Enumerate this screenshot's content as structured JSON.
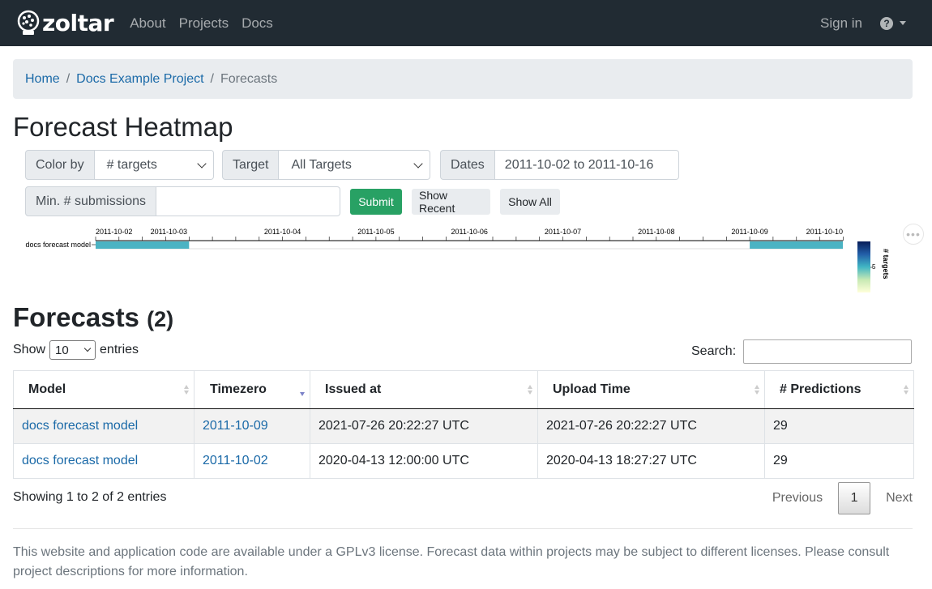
{
  "navbar": {
    "brand": "zoltar",
    "links": [
      "About",
      "Projects",
      "Docs"
    ],
    "sign_in": "Sign in",
    "help_glyph": "?"
  },
  "breadcrumb": {
    "home": "Home",
    "project": "Docs Example Project",
    "current": "Forecasts",
    "separator": "/"
  },
  "page_title": "Forecast Heatmap",
  "filters": {
    "color_by_label": "Color by",
    "color_by_value": "# targets",
    "target_label": "Target",
    "target_value": "All Targets",
    "dates_label": "Dates",
    "dates_value": "2011-10-02 to 2011-10-16",
    "min_submissions_label": "Min. # submissions",
    "min_submissions_value": "",
    "submit": "Submit",
    "show_recent": "Show Recent",
    "show_all": "Show All"
  },
  "heatmap": {
    "row_label": "docs forecast model",
    "dates": [
      "2011-10-02",
      "2011-10-03",
      "2011-10-04",
      "2011-10-05",
      "2011-10-06",
      "2011-10-07",
      "2011-10-08",
      "2011-10-09",
      "2011-10-10"
    ],
    "cells": [
      {
        "timezero": "2011-10-02",
        "targets": 29
      },
      {
        "timezero": "2011-10-09",
        "targets": 29
      }
    ],
    "cell_color": "#4bb3c3",
    "legend_title": "# targets",
    "legend_tick": "5",
    "legend_colors": [
      "#ffffd9",
      "#c7e9b4",
      "#41b6c4",
      "#225ea8",
      "#081d58"
    ]
  },
  "forecasts": {
    "title": "Forecasts",
    "count": "(2)",
    "show_label": "Show",
    "entries_value": "10",
    "entries_label": "entries",
    "search_label": "Search:",
    "columns": [
      "Model",
      "Timezero",
      "Issued at",
      "Upload Time",
      "# Predictions"
    ],
    "rows": [
      {
        "model": "docs forecast model",
        "timezero": "2011-10-09",
        "issued_at": "2021-07-26 20:22:27 UTC",
        "upload_time": "2021-07-26 20:22:27 UTC",
        "predictions": "29"
      },
      {
        "model": "docs forecast model",
        "timezero": "2011-10-02",
        "issued_at": "2020-04-13 12:00:00 UTC",
        "upload_time": "2020-04-13 18:27:27 UTC",
        "predictions": "29"
      }
    ],
    "info": "Showing 1 to 2 of 2 entries",
    "previous": "Previous",
    "page": "1",
    "next": "Next"
  },
  "footer": "This website and application code are available under a GPLv3 license. Forecast data within projects may be subject to different licenses. Please consult project descriptions for more information."
}
